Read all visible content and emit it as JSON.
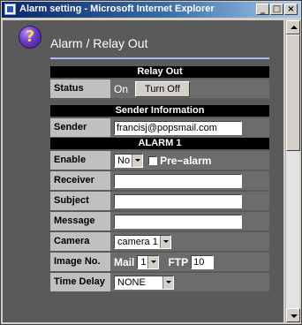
{
  "window": {
    "title": "Alarm setting - Microsoft Internet Explorer",
    "buttons": {
      "minimize": "_",
      "maximize": "□",
      "close": "×"
    }
  },
  "page": {
    "title": "Alarm / Relay Out",
    "icon": "help-icon"
  },
  "relay_out": {
    "header": "Relay Out",
    "status_label": "Status",
    "status_value": "On",
    "turn_off_button": "Turn Off"
  },
  "sender": {
    "header": "Sender Information",
    "label": "Sender",
    "value": "francisj@popsmail.com"
  },
  "alarm": {
    "header": "ALARM 1",
    "enable_label": "Enable",
    "enable_value": "No",
    "prealarm_label": "Pre−alarm",
    "receiver_label": "Receiver",
    "receiver_value": "",
    "subject_label": "Subject",
    "subject_value": "",
    "message_label": "Message",
    "message_value": "",
    "camera_label": "Camera",
    "camera_value": "camera 1",
    "image_label": "Image No.",
    "mail_label": "Mail",
    "mail_value": "1",
    "ftp_label": "FTP",
    "ftp_value": "10",
    "time_delay_label": "Time Delay",
    "time_delay_value": "NONE"
  }
}
